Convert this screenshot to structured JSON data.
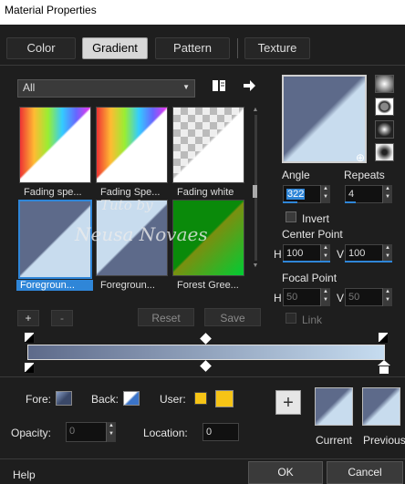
{
  "window": {
    "title": "Material Properties"
  },
  "tabs": [
    {
      "label": "Color"
    },
    {
      "label": "Gradient"
    },
    {
      "label": "Pattern"
    },
    {
      "label": "Texture"
    }
  ],
  "filter": {
    "value": "All"
  },
  "gradients": [
    {
      "label": "Fading spe..."
    },
    {
      "label": "Fading Spe..."
    },
    {
      "label": "Fading white"
    },
    {
      "label": "Foregroun..."
    },
    {
      "label": "Foregroun..."
    },
    {
      "label": "Forest Gree..."
    }
  ],
  "watermark": {
    "line1": "Tuto by",
    "line2": "Neusa Novaes"
  },
  "controls": {
    "angle_label": "Angle",
    "angle_value": "322",
    "repeats_label": "Repeats",
    "repeats_value": "4",
    "invert_label": "Invert",
    "center_point_label": "Center Point",
    "focal_point_label": "Focal Point",
    "h_label": "H",
    "v_label": "V",
    "center_h": "100",
    "center_v": "100",
    "focal_h": "50",
    "focal_v": "50",
    "link_label": "Link"
  },
  "editor": {
    "add": "+",
    "remove": "-",
    "reset": "Reset",
    "save": "Save"
  },
  "bottom": {
    "fore_label": "Fore:",
    "back_label": "Back:",
    "user_label": "User:",
    "opacity_label": "Opacity:",
    "opacity_value": "0",
    "location_label": "Location:",
    "location_value": "0",
    "add_button": "+",
    "current_label": "Current",
    "previous_label": "Previous"
  },
  "footer": {
    "help": "Help",
    "ok": "OK",
    "cancel": "Cancel"
  },
  "colors": {
    "gradient_start": "#5d6a8a",
    "gradient_end": "#c6dcf0",
    "user_color": "#f6c416",
    "accent": "#2f86d8"
  }
}
